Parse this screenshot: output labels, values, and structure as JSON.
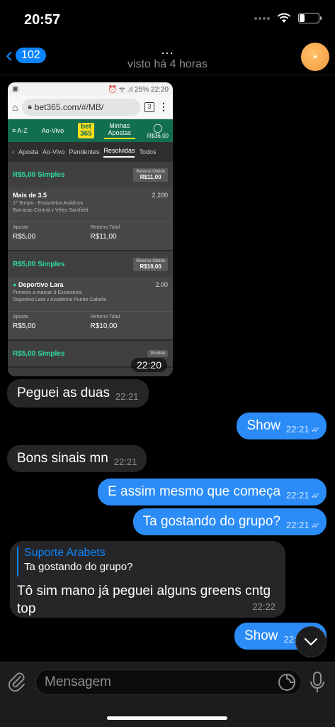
{
  "status_bar": {
    "time": "20:57"
  },
  "header": {
    "back_count": "102",
    "typing": "...",
    "subtitle": "visto há 4 horas"
  },
  "image_message": {
    "time": "22:20",
    "screenshot": {
      "status_right": "⏰ ᯤ .ıl 25% 22:20",
      "url": "bet365.com/#/MB/",
      "tabs_count": "3",
      "nav": [
        "≡ A-Z",
        "Ao-Vivo",
        "bet",
        "365",
        "Minhas Apostas",
        "R$36,00"
      ],
      "subnav": [
        "‹",
        "Aposta",
        "Ao-Vivo",
        "Pendentes",
        "Resolvidas",
        "Todos"
      ],
      "bets": [
        {
          "title": "R$5,00 Simples",
          "return_label": "Retorno Obtido",
          "return_value": "R$11,00",
          "selection": "Mais de 3.5",
          "odds": "2.200",
          "market": "1º Tempo - Escanteios Asiáticos",
          "event": "Barracas Central v Vélez Sarsfield",
          "stake_label": "Aposta",
          "stake": "R$5,00",
          "total_label": "Retorno Total",
          "total": "R$11,00"
        },
        {
          "title": "R$5,00 Simples",
          "return_label": "Retorno Obtido",
          "return_value": "R$10,00",
          "selection": "Deportivo Lara",
          "odds": "2.00",
          "market": "Primeiro a marcar 9 Escanteios",
          "event": "Deportivo Lara v Academia Puerto Cabello",
          "stake_label": "Aposta",
          "stake": "R$5,00",
          "total_label": "Retorno Total",
          "total": "R$10,00"
        },
        {
          "title": "R$5,00 Simples",
          "return_label": "Perdida"
        }
      ]
    }
  },
  "messages": [
    {
      "text": "Peguei as duas",
      "time": "22:21"
    },
    {
      "text": "Show",
      "time": "22:21"
    },
    {
      "text": "Bons sinais mn",
      "time": "22:21"
    },
    {
      "text": "E assim mesmo que começa",
      "time": "22:21"
    },
    {
      "text": "Ta gostando do grupo?",
      "time": "22:21"
    }
  ],
  "reply": {
    "author": "Suporte Arabets",
    "quoted": "Ta gostando do grupo?",
    "text": "Tô sim mano já peguei alguns greens cntg top",
    "time": "22:22"
  },
  "last_message": {
    "text": "Show",
    "time": "22:22"
  },
  "input": {
    "placeholder": "Mensagem"
  },
  "colors": {
    "accent": "#0a84ff",
    "outgoing": "#2b8cf7",
    "incoming": "#262628",
    "bet_green": "#126e51"
  }
}
